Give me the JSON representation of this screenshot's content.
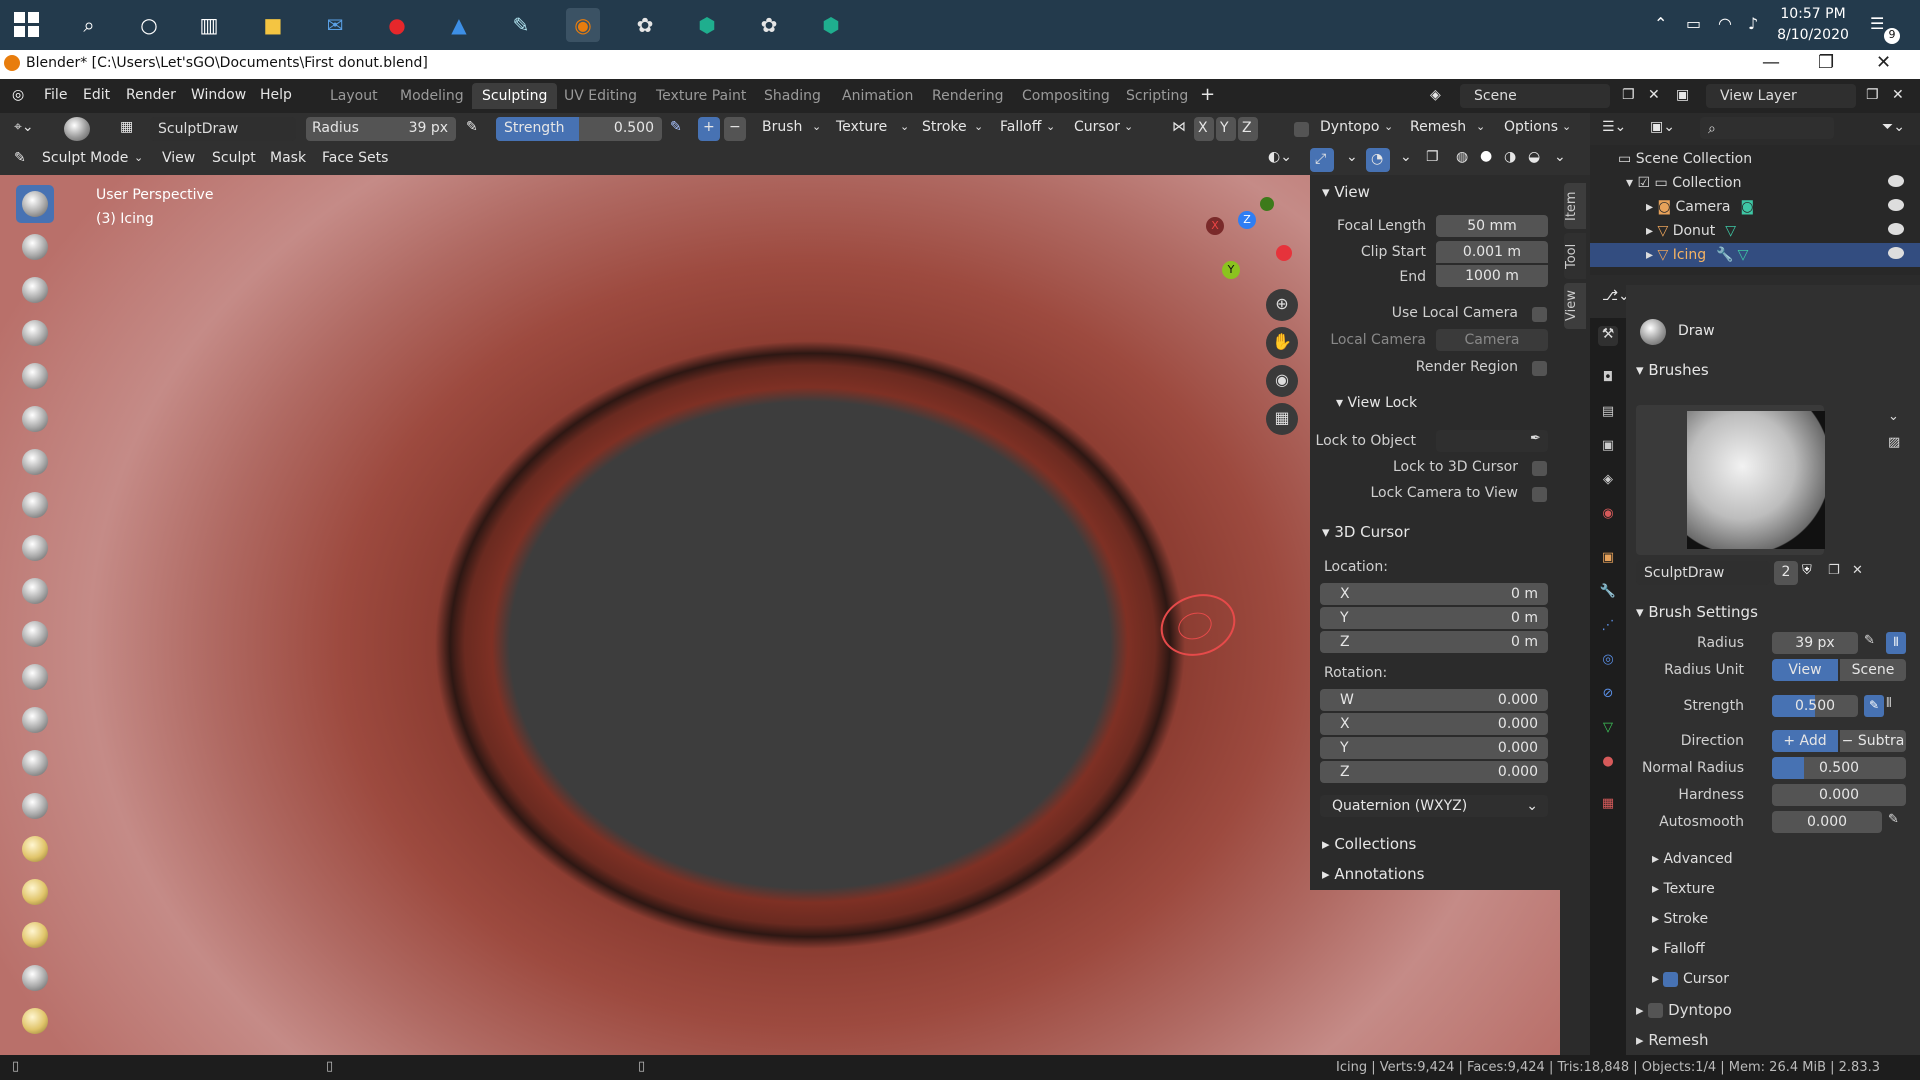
{
  "taskbar": {
    "time": "10:57 PM",
    "date": "8/10/2020",
    "notif_count": "9"
  },
  "window": {
    "title": "Blender* [C:\\Users\\Let'sGO\\Documents\\First donut.blend]"
  },
  "menu": {
    "items": [
      "File",
      "Edit",
      "Render",
      "Window",
      "Help"
    ],
    "workspaces": [
      "Layout",
      "Modeling",
      "Sculpting",
      "UV Editing",
      "Texture Paint",
      "Shading",
      "Animation",
      "Rendering",
      "Compositing",
      "Scripting"
    ],
    "active_workspace": "Sculpting",
    "scene": "Scene",
    "view_layer": "View Layer"
  },
  "toolheader": {
    "brush_name": "SculptDraw",
    "radius_label": "Radius",
    "radius_value": "39 px",
    "strength_label": "Strength",
    "strength_value": "0.500",
    "menus": [
      "Brush",
      "Texture",
      "Stroke",
      "Falloff",
      "Cursor"
    ],
    "axes": [
      "X",
      "Y",
      "Z"
    ],
    "dyntopo": "Dyntopo",
    "remesh": "Remesh",
    "options": "Options"
  },
  "header2": {
    "mode": "Sculpt Mode",
    "menus": [
      "View",
      "Sculpt",
      "Mask",
      "Face Sets"
    ]
  },
  "viewport": {
    "perspective": "User Perspective",
    "object": "(3) Icing",
    "gizmo_axes": [
      "X",
      "Y",
      "Z"
    ]
  },
  "npanel": {
    "view_title": "View",
    "focal_length_label": "Focal Length",
    "focal_length": "50 mm",
    "clip_start_label": "Clip Start",
    "clip_start": "0.001 m",
    "end_label": "End",
    "end": "1000 m",
    "use_local_camera": "Use Local Camera",
    "local_camera_label": "Local Camera",
    "local_camera_value": "Camera",
    "render_region": "Render Region",
    "view_lock_title": "View Lock",
    "lock_to_object": "Lock to Object",
    "lock_3d_cursor": "Lock to 3D Cursor",
    "lock_camera": "Lock Camera to View",
    "cursor_title": "3D Cursor",
    "location_label": "Location:",
    "loc": [
      {
        "axis": "X",
        "value": "0 m"
      },
      {
        "axis": "Y",
        "value": "0 m"
      },
      {
        "axis": "Z",
        "value": "0 m"
      }
    ],
    "rotation_label": "Rotation:",
    "rot": [
      {
        "axis": "W",
        "value": "0.000"
      },
      {
        "axis": "X",
        "value": "0.000"
      },
      {
        "axis": "Y",
        "value": "0.000"
      },
      {
        "axis": "Z",
        "value": "0.000"
      }
    ],
    "rotation_mode": "Quaternion (WXYZ)",
    "collections": "Collections",
    "annotations": "Annotations",
    "tabs": [
      "Item",
      "Tool",
      "View"
    ]
  },
  "outliner": {
    "scene_collection": "Scene Collection",
    "collection": "Collection",
    "items": [
      "Camera",
      "Donut",
      "Icing"
    ]
  },
  "props": {
    "brush_label": "Draw",
    "brushes_title": "Brushes",
    "brush_name": "SculptDraw",
    "brush_users": "2",
    "brush_settings_title": "Brush Settings",
    "radius_label": "Radius",
    "radius": "39 px",
    "radius_unit_label": "Radius Unit",
    "unit_view": "View",
    "unit_scene": "Scene",
    "strength_label": "Strength",
    "strength": "0.500",
    "direction_label": "Direction",
    "dir_add": "+ Add",
    "dir_sub": "− Subtra",
    "normal_radius_label": "Normal Radius",
    "normal_radius": "0.500",
    "hardness_label": "Hardness",
    "hardness": "0.000",
    "autosmooth_label": "Autosmooth",
    "autosmooth": "0.000",
    "subpanels": [
      "Advanced",
      "Texture",
      "Stroke",
      "Falloff",
      "Cursor"
    ],
    "dyntopo": "Dyntopo",
    "remesh": "Remesh"
  },
  "status": {
    "text": "Icing | Verts:9,424 | Faces:9,424 | Tris:18,848 | Objects:1/4 | Mem: 26.4 MiB | 2.83.3"
  }
}
